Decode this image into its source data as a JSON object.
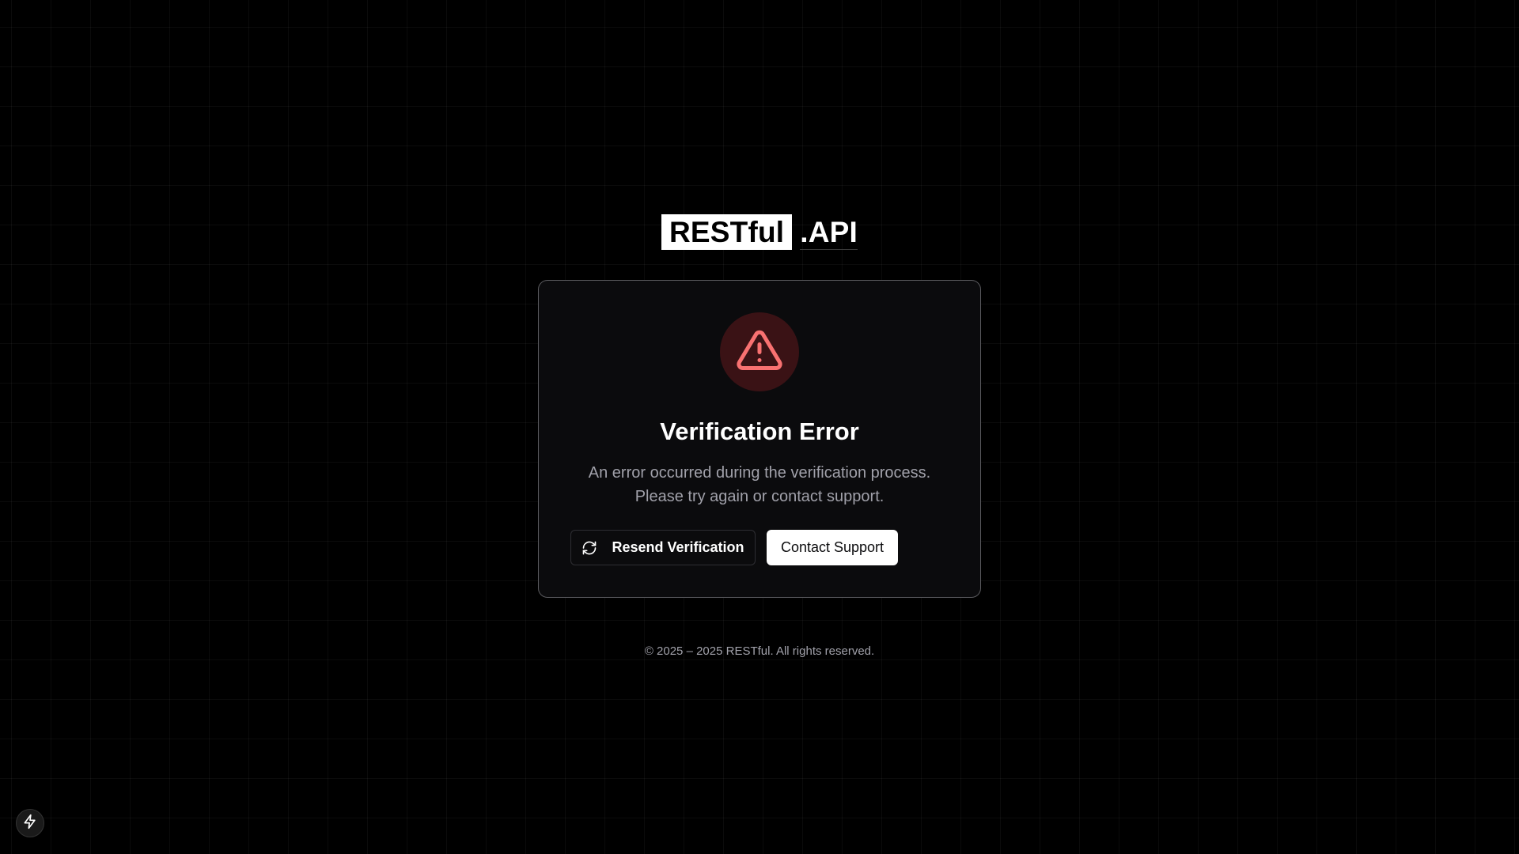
{
  "logo": {
    "brand": "RESTful",
    "suffix": ".API"
  },
  "card": {
    "icon": "alert-triangle-icon",
    "title": "Verification Error",
    "message_line1": "An error occurred during the verification process.",
    "message_line2": "Please try again or contact support.",
    "resend_button": {
      "label": "Resend Verification",
      "icon": "refresh-icon"
    },
    "support_button": {
      "label": "Contact Support"
    }
  },
  "footer": {
    "copyright": "© 2025 – 2025 RESTful. All rights reserved."
  },
  "corner_badge": {
    "icon": "lightning-bolt-icon"
  },
  "colors": {
    "background": "#000000",
    "card_background": "#0b0b0d",
    "card_border": "#5a5a5e",
    "error_accent": "#f87171",
    "error_circle": "#3a1215",
    "muted_text": "#a1a1aa"
  }
}
